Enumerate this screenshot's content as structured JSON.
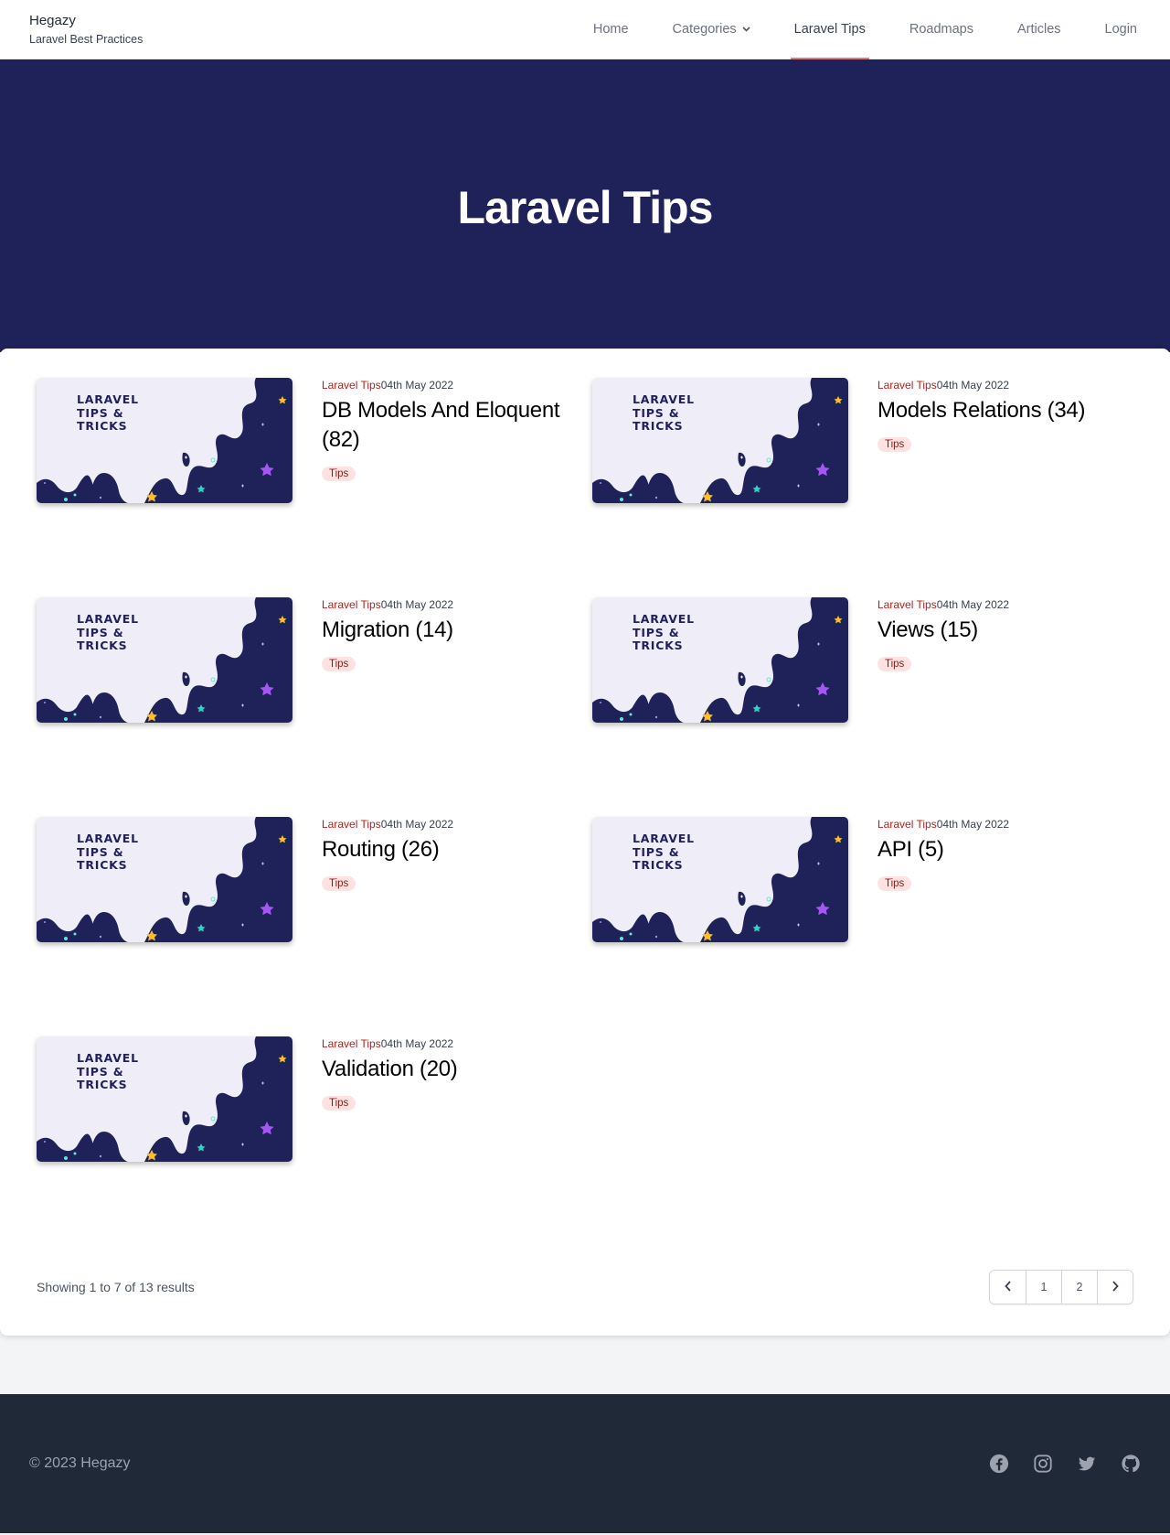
{
  "brand": {
    "name": "Hegazy",
    "tagline": "Laravel Best Practices"
  },
  "nav": {
    "home": "Home",
    "categories": "Categories",
    "laravel_tips": "Laravel Tips",
    "roadmaps": "Roadmaps",
    "articles": "Articles",
    "login": "Login"
  },
  "hero": {
    "title": "Laravel Tips"
  },
  "thumbnail": {
    "text": "LARAVEL\nTIPS &\nTRICKS"
  },
  "posts": [
    {
      "category": "Laravel Tips",
      "date": "04th May 2022",
      "title": "DB Models And Eloquent (82)",
      "tag": "Tips"
    },
    {
      "category": "Laravel Tips",
      "date": "04th May 2022",
      "title": "Models Relations (34)",
      "tag": "Tips"
    },
    {
      "category": "Laravel Tips",
      "date": "04th May 2022",
      "title": "Migration (14)",
      "tag": "Tips"
    },
    {
      "category": "Laravel Tips",
      "date": "04th May 2022",
      "title": "Views (15)",
      "tag": "Tips"
    },
    {
      "category": "Laravel Tips",
      "date": "04th May 2022",
      "title": "Routing (26)",
      "tag": "Tips"
    },
    {
      "category": "Laravel Tips",
      "date": "04th May 2022",
      "title": "API (5)",
      "tag": "Tips"
    },
    {
      "category": "Laravel Tips",
      "date": "04th May 2022",
      "title": "Validation (20)",
      "tag": "Tips"
    }
  ],
  "pagination": {
    "results_text": "Showing 1 to 7 of 13 results",
    "pages": [
      "1",
      "2"
    ],
    "prev_icon": "chevron-left-icon",
    "next_icon": "chevron-right-icon"
  },
  "footer": {
    "copyright": "© 2023 Hegazy",
    "socials": [
      "facebook-icon",
      "instagram-icon",
      "twitter-icon",
      "github-icon"
    ]
  },
  "colors": {
    "hero_bg": "#1f2159",
    "accent": "#e07b7b",
    "category_text": "#b91c1c",
    "tag_bg": "#fde2e2",
    "footer_bg": "#1f2937",
    "thumb_light": "#efeef8"
  }
}
